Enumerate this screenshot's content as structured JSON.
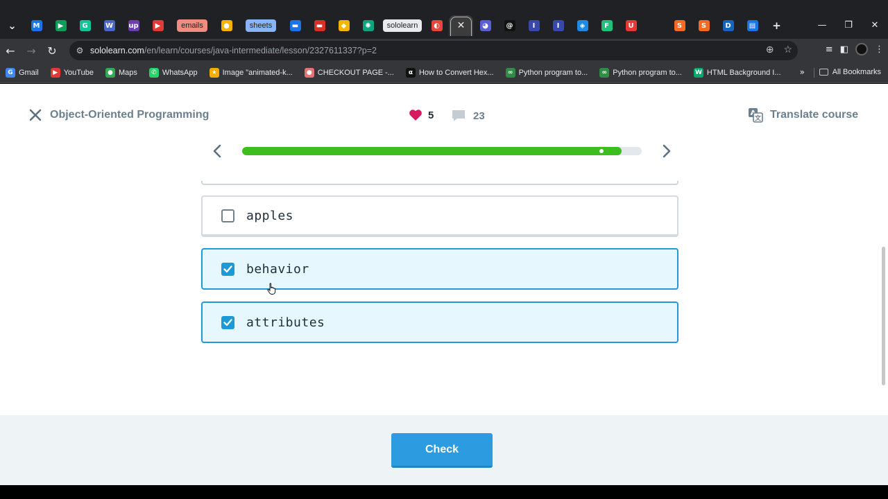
{
  "browser": {
    "tabs": [
      {
        "icon": "chevron-down-icon",
        "glyph": "⌄",
        "color": "#202124"
      },
      {
        "icon": "gmail-m-icon",
        "glyph": "M",
        "color": "#1a73e8"
      },
      {
        "icon": "play-store-icon",
        "glyph": "▶",
        "color": "#0f9d58"
      },
      {
        "icon": "grammarly-icon",
        "glyph": "G",
        "color": "#15c39a"
      },
      {
        "icon": "site-icon",
        "glyph": "W",
        "color": "#4a67c6"
      },
      {
        "icon": "upwork-icon",
        "glyph": "up",
        "color": "#6b3fb0"
      },
      {
        "icon": "youtube-icon",
        "glyph": "▶",
        "color": "#e53935"
      },
      {
        "label": "emails",
        "bg": "#f28b82",
        "wide": true
      },
      {
        "icon": "maps-pin-icon",
        "glyph": "●",
        "color": "#f4b400"
      },
      {
        "label": "sheets",
        "bg": "#8ab4f8",
        "wide": true
      },
      {
        "icon": "docs-icon",
        "glyph": "▬",
        "color": "#1a73e8"
      },
      {
        "icon": "slides-icon",
        "glyph": "▬",
        "color": "#d93025"
      },
      {
        "icon": "drive-icon",
        "glyph": "◆",
        "color": "#f4b400"
      },
      {
        "icon": "chatgpt-icon",
        "glyph": "✺",
        "color": "#10a37f"
      },
      {
        "label": "sololearn",
        "bg": "#e8eaed",
        "wide": true
      },
      {
        "icon": "loader-icon",
        "glyph": "◐",
        "color": "#e8453c"
      },
      {
        "icon": "close-tab-icon",
        "glyph": "✕",
        "active": true
      },
      {
        "icon": "site-icon",
        "glyph": "◕",
        "color": "#5b5fd6"
      },
      {
        "icon": "threads-icon",
        "glyph": "@",
        "color": "#111"
      },
      {
        "icon": "site-icon",
        "glyph": "I",
        "color": "#3949ab"
      },
      {
        "icon": "site-icon",
        "glyph": "I",
        "color": "#3949ab"
      },
      {
        "icon": "graduation-icon",
        "glyph": "◈",
        "color": "#1e88e5"
      },
      {
        "icon": "site-icon",
        "glyph": "F",
        "color": "#21c17a"
      },
      {
        "icon": "site-icon",
        "glyph": "U",
        "color": "#e53935"
      },
      {
        "icon": "blank-icon",
        "glyph": "",
        "color": "transparent"
      },
      {
        "icon": "sololearn-icon",
        "glyph": "S",
        "color": "#f26b21"
      },
      {
        "icon": "sololearn-icon",
        "glyph": "S",
        "color": "#f26b21"
      },
      {
        "icon": "site-icon",
        "glyph": "D",
        "color": "#1565c0"
      },
      {
        "icon": "docs-icon",
        "glyph": "▤",
        "color": "#1a73e8"
      },
      {
        "icon": "new-tab-icon",
        "glyph": "+",
        "color": "transparent"
      }
    ],
    "window_controls": [
      "—",
      "❐",
      "✕"
    ],
    "url_host": "sololearn.com",
    "url_path": "/en/learn/courses/java-intermediate/lesson/2327611337?p=2",
    "bookmarks": [
      {
        "label": "Gmail",
        "icon": "google-icon",
        "glyph": "G",
        "color": "#4285f4"
      },
      {
        "label": "YouTube",
        "icon": "youtube-icon",
        "glyph": "▶",
        "color": "#e53935"
      },
      {
        "label": "Maps",
        "icon": "maps-pin-icon",
        "glyph": "●",
        "color": "#34a853"
      },
      {
        "label": "WhatsApp",
        "icon": "whatsapp-icon",
        "glyph": "✆",
        "color": "#25d366"
      },
      {
        "label": "Image \"animated-k...",
        "icon": "star-icon",
        "glyph": "★",
        "color": "#f9ab00"
      },
      {
        "label": "CHECKOUT PAGE -...",
        "icon": "site-icon",
        "glyph": "●",
        "color": "#e57373"
      },
      {
        "label": "How to Convert Hex...",
        "icon": "alpha-icon",
        "glyph": "α",
        "color": "#111"
      },
      {
        "label": "Python program to...",
        "icon": "gfg-icon",
        "glyph": "∞",
        "color": "#2f8d46"
      },
      {
        "label": "Python program to...",
        "icon": "gfg-icon",
        "glyph": "∞",
        "color": "#2f8d46"
      },
      {
        "label": "HTML Background I...",
        "icon": "w3-icon",
        "glyph": "W",
        "color": "#04aa6d"
      }
    ],
    "all_bookmarks_label": "All Bookmarks"
  },
  "lesson": {
    "course_title": "Object-Oriented Programming",
    "hearts": "5",
    "comments": "23",
    "translate_label": "Translate course",
    "progress": 0.95,
    "options": [
      {
        "label": "apples",
        "checked": false
      },
      {
        "label": "behavior",
        "checked": true
      },
      {
        "label": "attributes",
        "checked": true
      }
    ],
    "check_label": "Check"
  },
  "colors": {
    "progress": "#3dbd1e",
    "heart": "#d81b60",
    "check_button": "#2d9be0",
    "checked_border": "#1f9ad6"
  }
}
